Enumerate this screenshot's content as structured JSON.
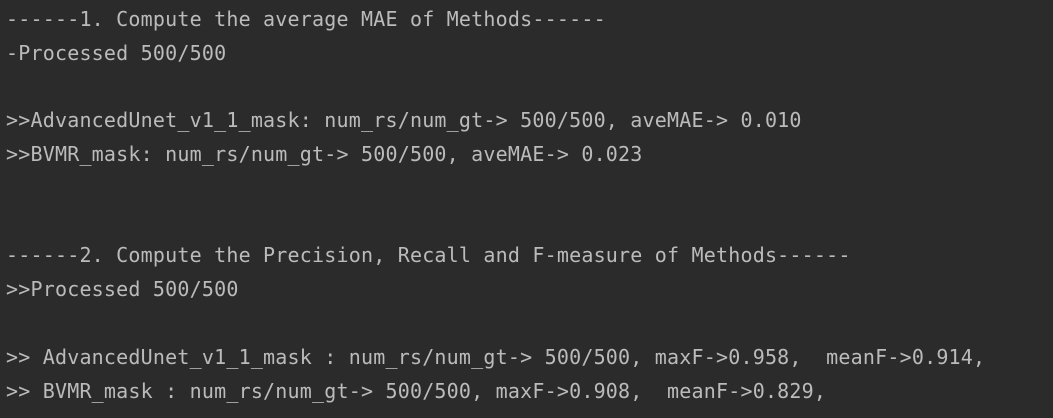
{
  "console": {
    "lines": [
      "------1. Compute the average MAE of Methods------",
      "-Processed 500/500",
      "",
      ">>AdvancedUnet_v1_1_mask: num_rs/num_gt-> 500/500, aveMAE-> 0.010",
      ">>BVMR_mask: num_rs/num_gt-> 500/500, aveMAE-> 0.023",
      "",
      "",
      "------2. Compute the Precision, Recall and F-measure of Methods------",
      ">>Processed 500/500",
      "",
      ">> AdvancedUnet_v1_1_mask : num_rs/num_gt-> 500/500, maxF->0.958,  meanF->0.914,",
      ">> BVMR_mask : num_rs/num_gt-> 500/500, maxF->0.908,  meanF->0.829,"
    ]
  },
  "colors": {
    "background": "#2b2b2b",
    "text": "#bbbbbb"
  }
}
